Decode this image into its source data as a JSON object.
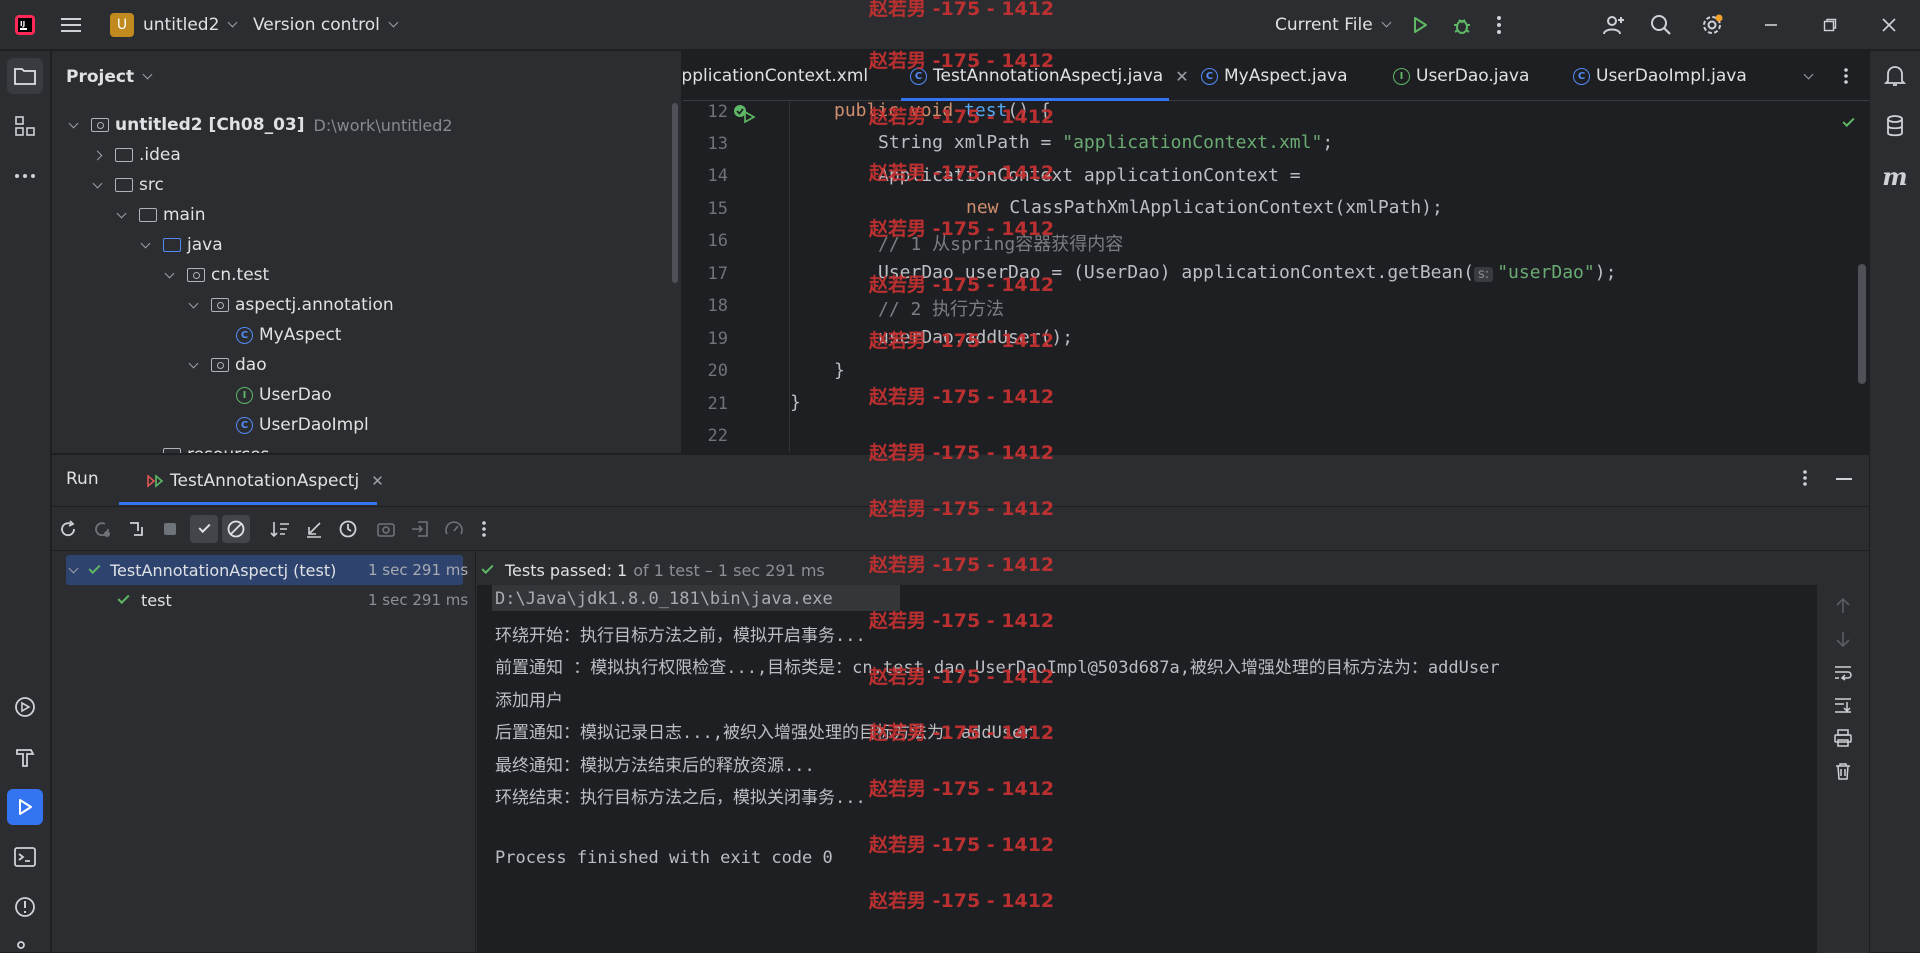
{
  "titlebar": {
    "project_badge": "U",
    "project_name": "untitled2",
    "vcs_label": "Version control",
    "run_config": "Current File"
  },
  "project_panel": {
    "title": "Project",
    "tree": [
      {
        "label": "untitled2 [Ch08_03]",
        "hint": "D:\\work\\untitled2"
      },
      {
        "label": ".idea"
      },
      {
        "label": "src"
      },
      {
        "label": "main"
      },
      {
        "label": "java"
      },
      {
        "label": "cn.test"
      },
      {
        "label": "aspectj.annotation"
      },
      {
        "label": "MyAspect"
      },
      {
        "label": "dao"
      },
      {
        "label": "UserDao"
      },
      {
        "label": "UserDaoImpl"
      },
      {
        "label": "resources"
      }
    ]
  },
  "editor": {
    "tabs": [
      {
        "label": "applicationContext.xml",
        "icon": "xml-icon"
      },
      {
        "label": "TestAnnotationAspectj.java",
        "icon": "class-icon",
        "active": true
      },
      {
        "label": "MyAspect.java",
        "icon": "class-icon"
      },
      {
        "label": "UserDao.java",
        "icon": "interface-icon"
      },
      {
        "label": "UserDaoImpl.java",
        "icon": "class-icon"
      }
    ],
    "line_numbers": [
      "12",
      "13",
      "14",
      "15",
      "16",
      "17",
      "18",
      "19",
      "20",
      "21",
      "22"
    ],
    "code": {
      "l12_kw": "public void ",
      "l12_fn": "test",
      "l12_rest": "() {",
      "l13_a": "String xmlPath = ",
      "l13_s": "\"applicationContext.xml\"",
      "l13_b": ";",
      "l14": "ApplicationContext applicationContext =",
      "l15_kw": "new ",
      "l15_rest": "ClassPathXmlApplicationContext(xmlPath);",
      "l16": "// 1 从spring容器获得内容",
      "l17_a": "UserDao userDao = (UserDao) applicationContext.getBean(",
      "l17_hint": "s:",
      "l17_s": "\"userDao\"",
      "l17_b": ");",
      "l18": "// 2 执行方法",
      "l19": "userDao.addUser();",
      "l20": "}",
      "l21": "}"
    }
  },
  "run_panel": {
    "tab_run": "Run",
    "tab_config": "TestAnnotationAspectj",
    "test_tree": [
      {
        "label": "TestAnnotationAspectj (test)",
        "time": "1 sec 291 ms",
        "status": "passed"
      },
      {
        "label": "test",
        "time": "1 sec 291 ms",
        "status": "passed"
      }
    ],
    "summary_passed": "Tests passed: 1",
    "summary_rest": "of 1 test – 1 sec 291 ms",
    "console_lines": [
      "D:\\Java\\jdk1.8.0_181\\bin\\java.exe",
      "环绕开始：执行目标方法之前，模拟开启事务...",
      "前置通知 ：模拟执行权限检查...,目标类是：cn.test.dao.UserDaoImpl@503d687a,被织入增强处理的目标方法为：addUser",
      "添加用户",
      "后置通知：模拟记录日志...,被织入增强处理的目标方法为：addUser",
      "最终通知：模拟方法结束后的释放资源...",
      "环绕结束：执行目标方法之后，模拟关闭事务...",
      "",
      "Process finished with exit code 0"
    ]
  },
  "watermark": "赵若男 -175 - 1412",
  "colors": {
    "accent": "#3574f0",
    "pass": "#5fb865",
    "watermark": "#c83232"
  }
}
